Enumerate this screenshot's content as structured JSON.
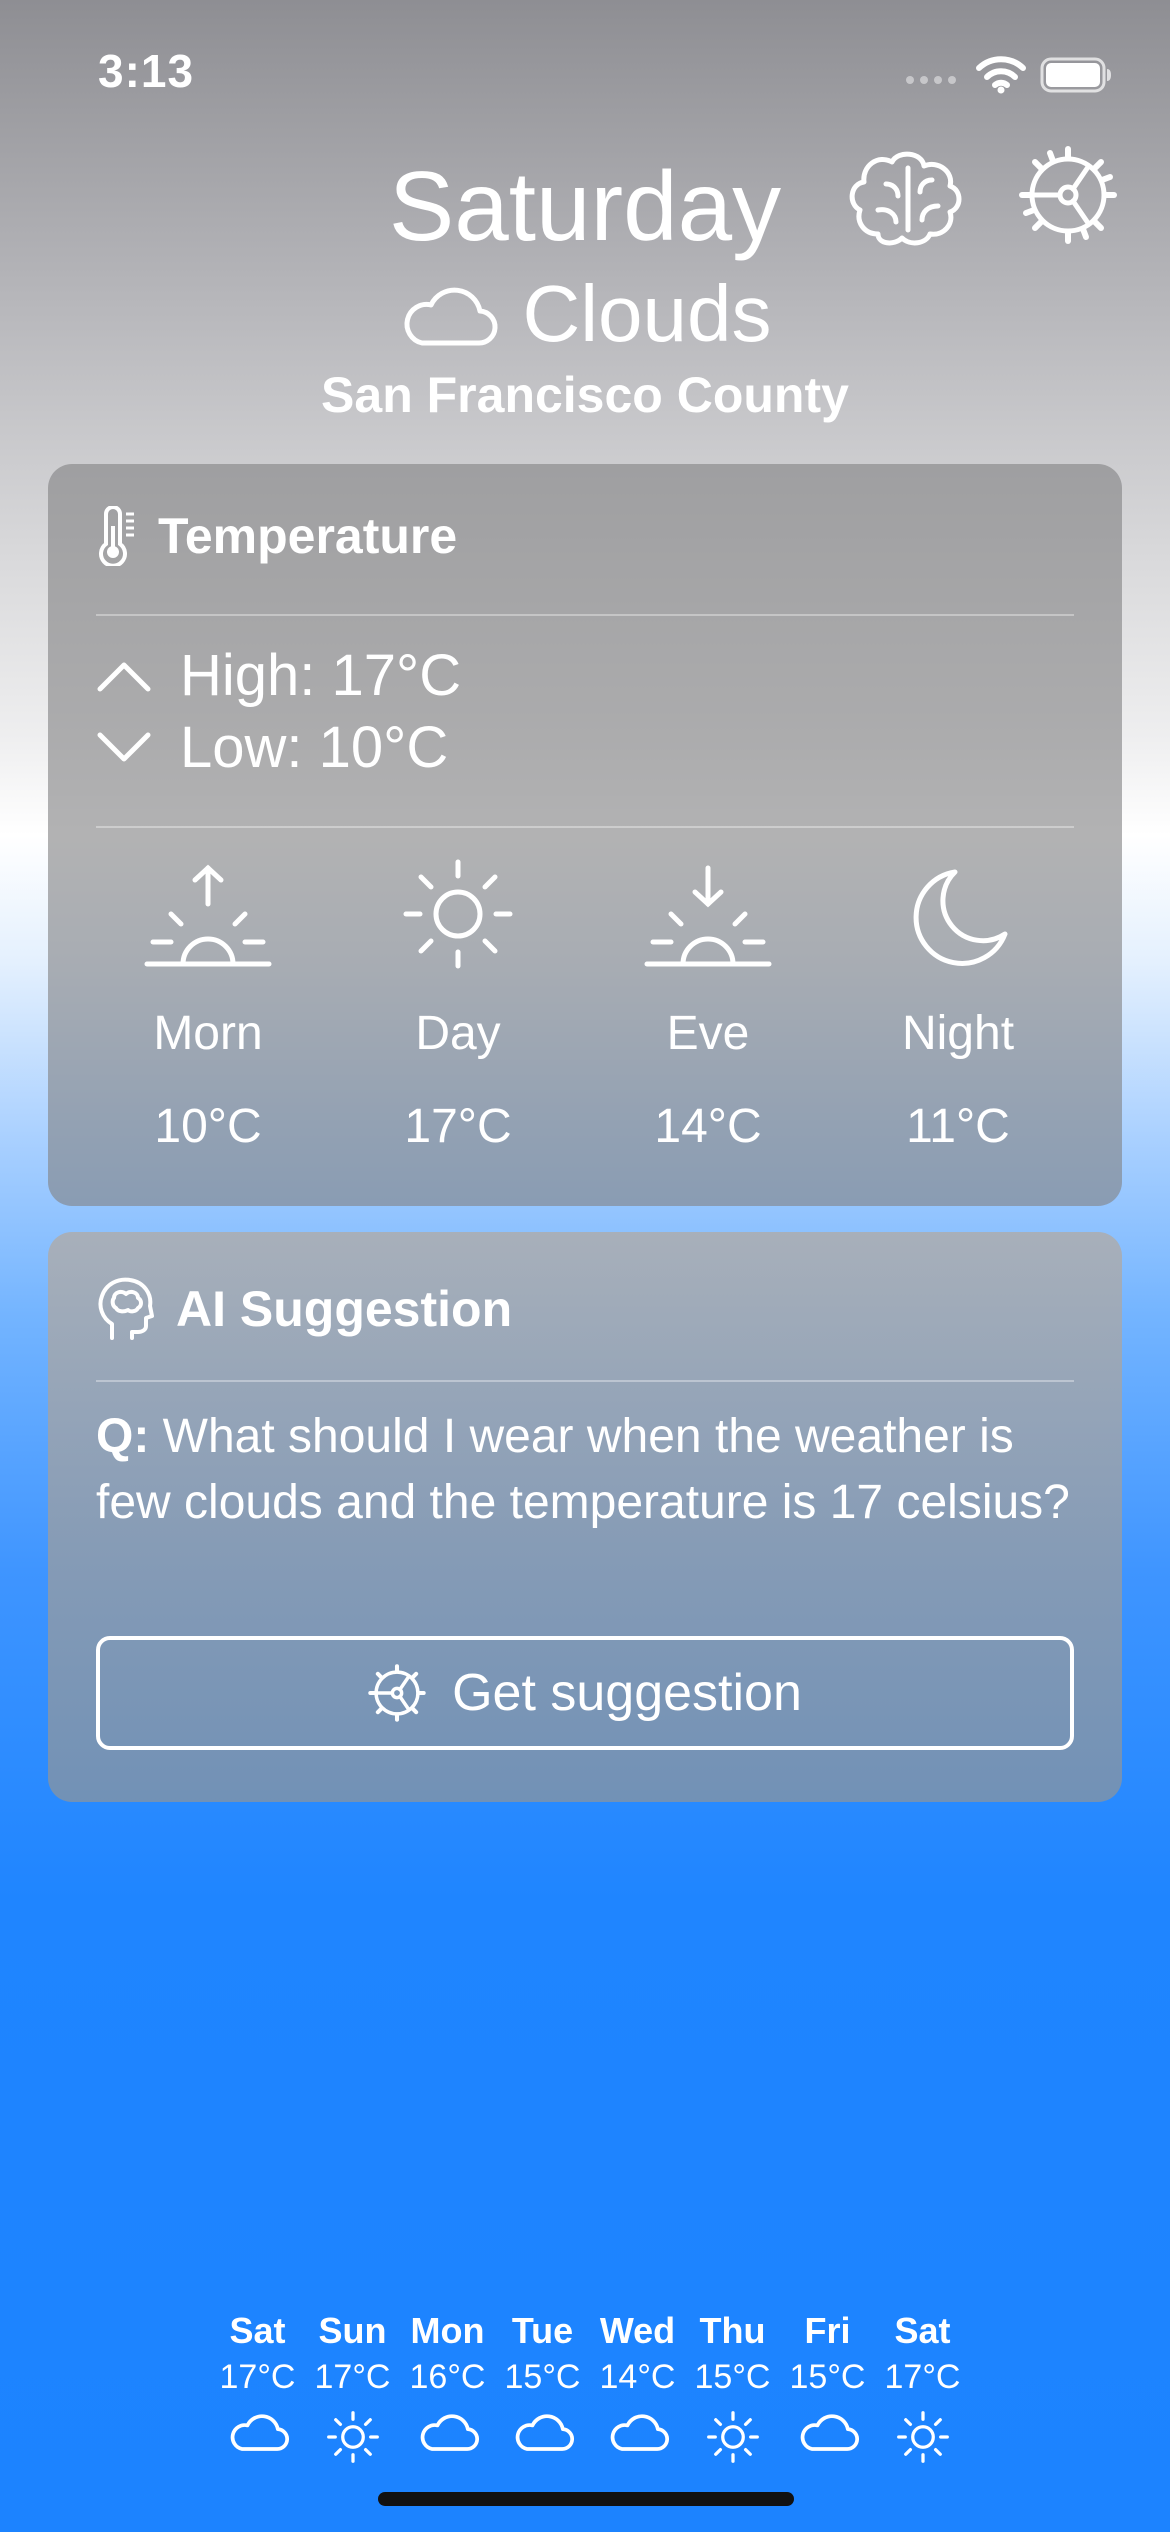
{
  "status_bar": {
    "time": "3:13"
  },
  "header": {
    "day": "Saturday",
    "condition": "Clouds",
    "location": "San Francisco County",
    "condition_icon": "cloud-icon",
    "brain_icon": "brain-icon",
    "settings_icon": "gear-icon"
  },
  "temperature_card": {
    "title": "Temperature",
    "high": "High: 17°C",
    "low": "Low: 10°C",
    "periods": [
      {
        "label": "Morn",
        "temp": "10°C",
        "icon": "sunrise-icon"
      },
      {
        "label": "Day",
        "temp": "17°C",
        "icon": "sun-icon"
      },
      {
        "label": "Eve",
        "temp": "14°C",
        "icon": "sunset-icon"
      },
      {
        "label": "Night",
        "temp": "11°C",
        "icon": "moon-icon"
      }
    ]
  },
  "ai_card": {
    "title": "AI Suggestion",
    "question_prefix": "Q:",
    "question": "What should I wear when the weather is few clouds and the temperature is 17 celsius?",
    "button_label": "Get suggestion"
  },
  "forecast": [
    {
      "day": "Sat",
      "temp": "17°C",
      "icon": "cloud-icon"
    },
    {
      "day": "Sun",
      "temp": "17°C",
      "icon": "sun-icon"
    },
    {
      "day": "Mon",
      "temp": "16°C",
      "icon": "cloud-icon"
    },
    {
      "day": "Tue",
      "temp": "15°C",
      "icon": "cloud-icon"
    },
    {
      "day": "Wed",
      "temp": "14°C",
      "icon": "cloud-icon"
    },
    {
      "day": "Thu",
      "temp": "15°C",
      "icon": "sun-icon"
    },
    {
      "day": "Fri",
      "temp": "15°C",
      "icon": "cloud-icon"
    },
    {
      "day": "Sat",
      "temp": "17°C",
      "icon": "sun-icon"
    }
  ]
}
